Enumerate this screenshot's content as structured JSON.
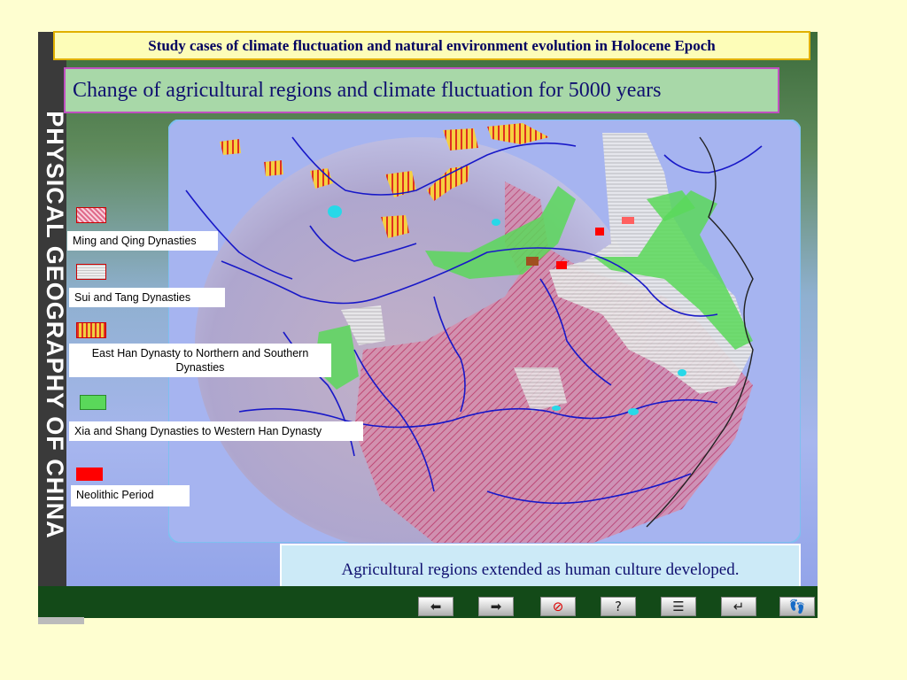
{
  "title": "Study cases of climate fluctuation and natural environment evolution in Holocene Epoch",
  "subtitle": "Change of agricultural regions and climate fluctuation for 5000 years",
  "side_label": "PHYSICAL GEOGRAPHY OF CHINA",
  "legend": [
    {
      "label": "Ming and Qing Dynasties",
      "pattern": "diagonal-red-hatch",
      "color": "#e06a8a"
    },
    {
      "label": "Sui and Tang Dynasties",
      "pattern": "horizontal-grey-lines",
      "color": "#c8c8c8"
    },
    {
      "label": "East Han Dynasty to Northern and Southern Dynasties",
      "pattern": "vertical-red-yellow-stripes",
      "color": "#f0d040"
    },
    {
      "label": "Xia and Shang Dynasties to Western Han Dynasty",
      "pattern": "green-fill",
      "color": "#5ad85a"
    },
    {
      "label": "Neolithic Period",
      "pattern": "solid-red",
      "color": "#ff0000"
    }
  ],
  "note": "Agricultural regions extended as human culture developed.",
  "nav": [
    {
      "name": "back-arrow-icon",
      "glyph": "⬅"
    },
    {
      "name": "forward-arrow-icon",
      "glyph": "➡"
    },
    {
      "name": "stop-icon",
      "glyph": "⊘"
    },
    {
      "name": "help-icon",
      "glyph": "?"
    },
    {
      "name": "menu-icon",
      "glyph": "☰"
    },
    {
      "name": "return-icon",
      "glyph": "↵"
    },
    {
      "name": "footprints-icon",
      "glyph": "👣"
    }
  ],
  "colors": {
    "page_bg": "#fefed0",
    "title_text": "#000060",
    "ming_qing": "#e06a8a",
    "xia_shang": "#5ad85a",
    "neolithic": "#ff0000",
    "rivers": "#1818c8"
  }
}
